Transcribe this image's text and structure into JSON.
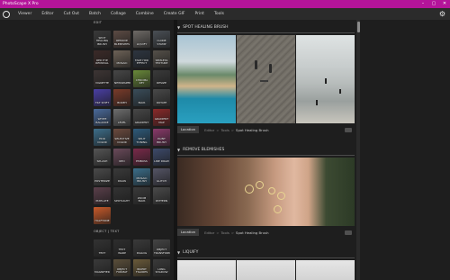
{
  "window": {
    "title": "PhotoScape X Pro",
    "controls": [
      "–",
      "▢",
      "✕"
    ]
  },
  "menu": {
    "items": [
      "Viewer",
      "Editor",
      "Cut Out",
      "Batch",
      "Collage",
      "Combine",
      "Create GIF",
      "Print",
      "Tools"
    ]
  },
  "sidebar": {
    "sections": [
      {
        "label": "EDIT",
        "tiles": [
          {
            "label": "SPOT HEALING BRUSH",
            "color": "#3a3a3a"
          },
          {
            "label": "REMOVE BLEMISHES",
            "color": "#5c4b44"
          },
          {
            "label": "LIQUIFY",
            "color": "#6e6a66"
          },
          {
            "label": "CLONE STAMP",
            "color": "#4a4f55"
          },
          {
            "label": "RED EYE REMOVAL",
            "color": "#3b2a28"
          },
          {
            "label": "MOSAIC",
            "color": "#6d6257"
          },
          {
            "label": "FAKE HDR EFFECT",
            "color": "#2d3540"
          },
          {
            "label": "SEMLESS TEXTURE",
            "color": "#555049"
          },
          {
            "label": "VIGNETTE",
            "color": "#3d3534"
          },
          {
            "label": "NEWSPAPER",
            "color": "#474747"
          },
          {
            "label": "CHROMA KEY",
            "color": "#6a8a3a"
          },
          {
            "label": "RESIZE",
            "color": "#3a3a3a"
          },
          {
            "label": "TILT SHIFT",
            "color": "#4a3fa4"
          },
          {
            "label": "BOKEH",
            "color": "#7a3b2a"
          },
          {
            "label": "BLUR",
            "color": "#3a4d5a"
          },
          {
            "label": "ROTATE",
            "color": "#494949"
          },
          {
            "label": "WHITE BALANCE",
            "color": "#4a6a9a"
          },
          {
            "label": "LEVEL",
            "color": "#6e6e6e"
          },
          {
            "label": "GRADIENT",
            "color": "#474747"
          },
          {
            "label": "GRADIENT MAP",
            "color": "#8a2a2a"
          },
          {
            "label": "HDR COLOR",
            "color": "#3d6e8a"
          },
          {
            "label": "SELECTIVE COLOR",
            "color": "#6a4a3e"
          },
          {
            "label": "SPLIT TONING",
            "color": "#2e5a7a"
          },
          {
            "label": "PAINT BRUSH",
            "color": "#8a3a6a"
          },
          {
            "label": "SPLASH",
            "color": "#555555"
          },
          {
            "label": "RED",
            "color": "#6a4a5a"
          },
          {
            "label": "EMBOSS",
            "color": "#7a2a4a"
          },
          {
            "label": "LINE DRAW",
            "color": "#3d4a6a"
          },
          {
            "label": "POSTERIZE",
            "color": "#4a4a4a"
          },
          {
            "label": "DRAW",
            "color": "#3a3a3a"
          },
          {
            "label": "MOSAIC BRUSH",
            "color": "#3b6e8a"
          },
          {
            "label": "GLITCH",
            "color": "#555566"
          },
          {
            "label": "PIXELATE",
            "color": "#5a3f4a"
          },
          {
            "label": "SPOTLIGHT",
            "color": "#333333"
          },
          {
            "label": "ZOOM BLUR",
            "color": "#3a3a3a"
          },
          {
            "label": "PATTERN",
            "color": "#4a4a4a"
          },
          {
            "label": "HALFTONE",
            "color": "#c85a2a"
          }
        ]
      },
      {
        "label": "OBJECT | TEXT",
        "tiles": [
          {
            "label": "TEXT",
            "color": "#333333"
          },
          {
            "label": "TEXT WARP",
            "color": "#2e2e2e"
          },
          {
            "label": "DIALOG",
            "color": "#3a3a3a"
          },
          {
            "label": "OBJECT TRANSFORM",
            "color": "#444444"
          },
          {
            "label": "MAGNIFIER",
            "color": "#3a3a3a"
          },
          {
            "label": "OBJECT FORMAT",
            "color": "#5a4e3a"
          },
          {
            "label": "INSERT FIGURES",
            "color": "#6a5a3a"
          },
          {
            "label": "LONG SHADOW",
            "color": "#3a3a3a"
          }
        ]
      }
    ]
  },
  "main": {
    "blocks": [
      {
        "title": "SPOT HEALING BRUSH",
        "location_label": "Location",
        "breadcrumb": [
          "Editor",
          "Tools",
          "Spot Healing Brush"
        ]
      },
      {
        "title": "REMOVE BLEMISHES",
        "location_label": "Location",
        "breadcrumb": [
          "Editor",
          "Tools",
          "Spot Healing Brush"
        ]
      },
      {
        "title": "LIQUIFY"
      }
    ]
  },
  "colors": {
    "titlebar": "#b4149a",
    "background": "#1e1e1e",
    "menubar": "#2b2b2b"
  }
}
